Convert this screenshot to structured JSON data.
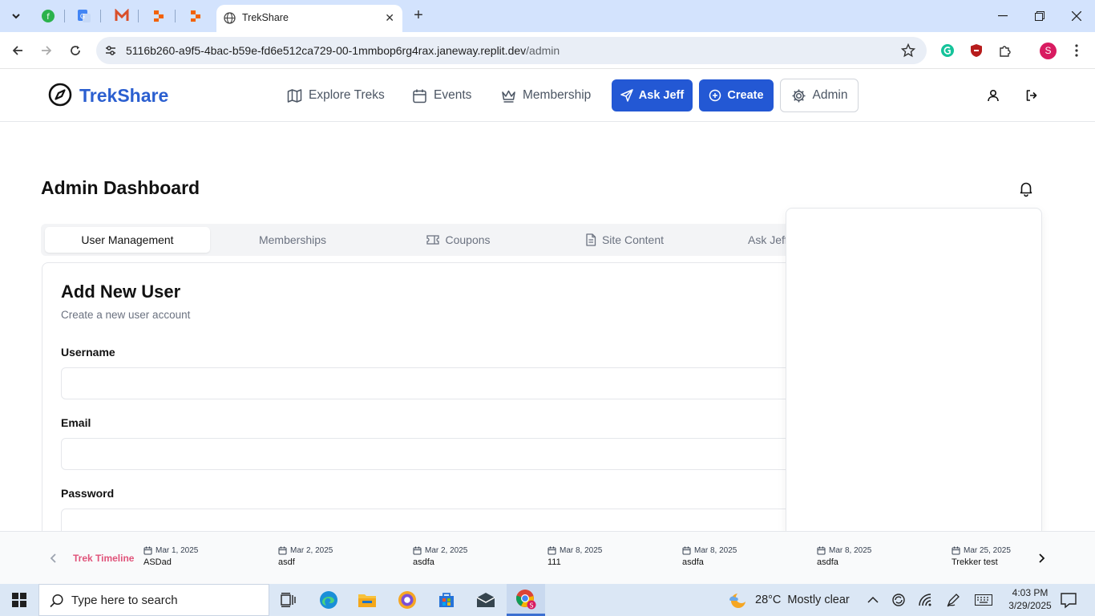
{
  "browser": {
    "active_tab_title": "TrekShare",
    "url_host": "5116b260-a9f5-4bac-b59e-fd6e512ca729-00-1mmbop6rg4rax.janeway.replit.dev",
    "url_path": "/admin",
    "profile_initial": "S"
  },
  "app": {
    "brand": "TrekShare",
    "nav": {
      "explore": "Explore Treks",
      "events": "Events",
      "membership": "Membership",
      "ask_jeff": "Ask Jeff",
      "create": "Create",
      "admin": "Admin"
    },
    "accent_color": "#2358d4",
    "brand_color": "#2b5fd0"
  },
  "page": {
    "title": "Admin Dashboard",
    "tabs": [
      {
        "label": "User Management",
        "active": true
      },
      {
        "label": "Memberships"
      },
      {
        "label": "Coupons"
      },
      {
        "label": "Site Content"
      },
      {
        "label": "Ask Jeff"
      }
    ],
    "card": {
      "title": "Add New User",
      "subtitle": "Create a new user account",
      "fields": [
        {
          "label": "Username",
          "value": ""
        },
        {
          "label": "Email",
          "value": ""
        },
        {
          "label": "Password",
          "value": ""
        }
      ]
    }
  },
  "timeline": {
    "label": "Trek Timeline",
    "label_color": "#e0537a",
    "items": [
      {
        "date": "Mar 1, 2025",
        "name": "ASDad"
      },
      {
        "date": "Mar 2, 2025",
        "name": "asdf"
      },
      {
        "date": "Mar 2, 2025",
        "name": "asdfa"
      },
      {
        "date": "Mar 8, 2025",
        "name": "111"
      },
      {
        "date": "Mar 8, 2025",
        "name": "asdfa"
      },
      {
        "date": "Mar 8, 2025",
        "name": "asdfa"
      },
      {
        "date": "Mar 25, 2025",
        "name": "Trekker test"
      }
    ]
  },
  "taskbar": {
    "search_placeholder": "Type here to search",
    "weather_temp": "28°C",
    "weather_desc": "Mostly clear",
    "time": "4:03 PM",
    "date": "3/29/2025"
  }
}
